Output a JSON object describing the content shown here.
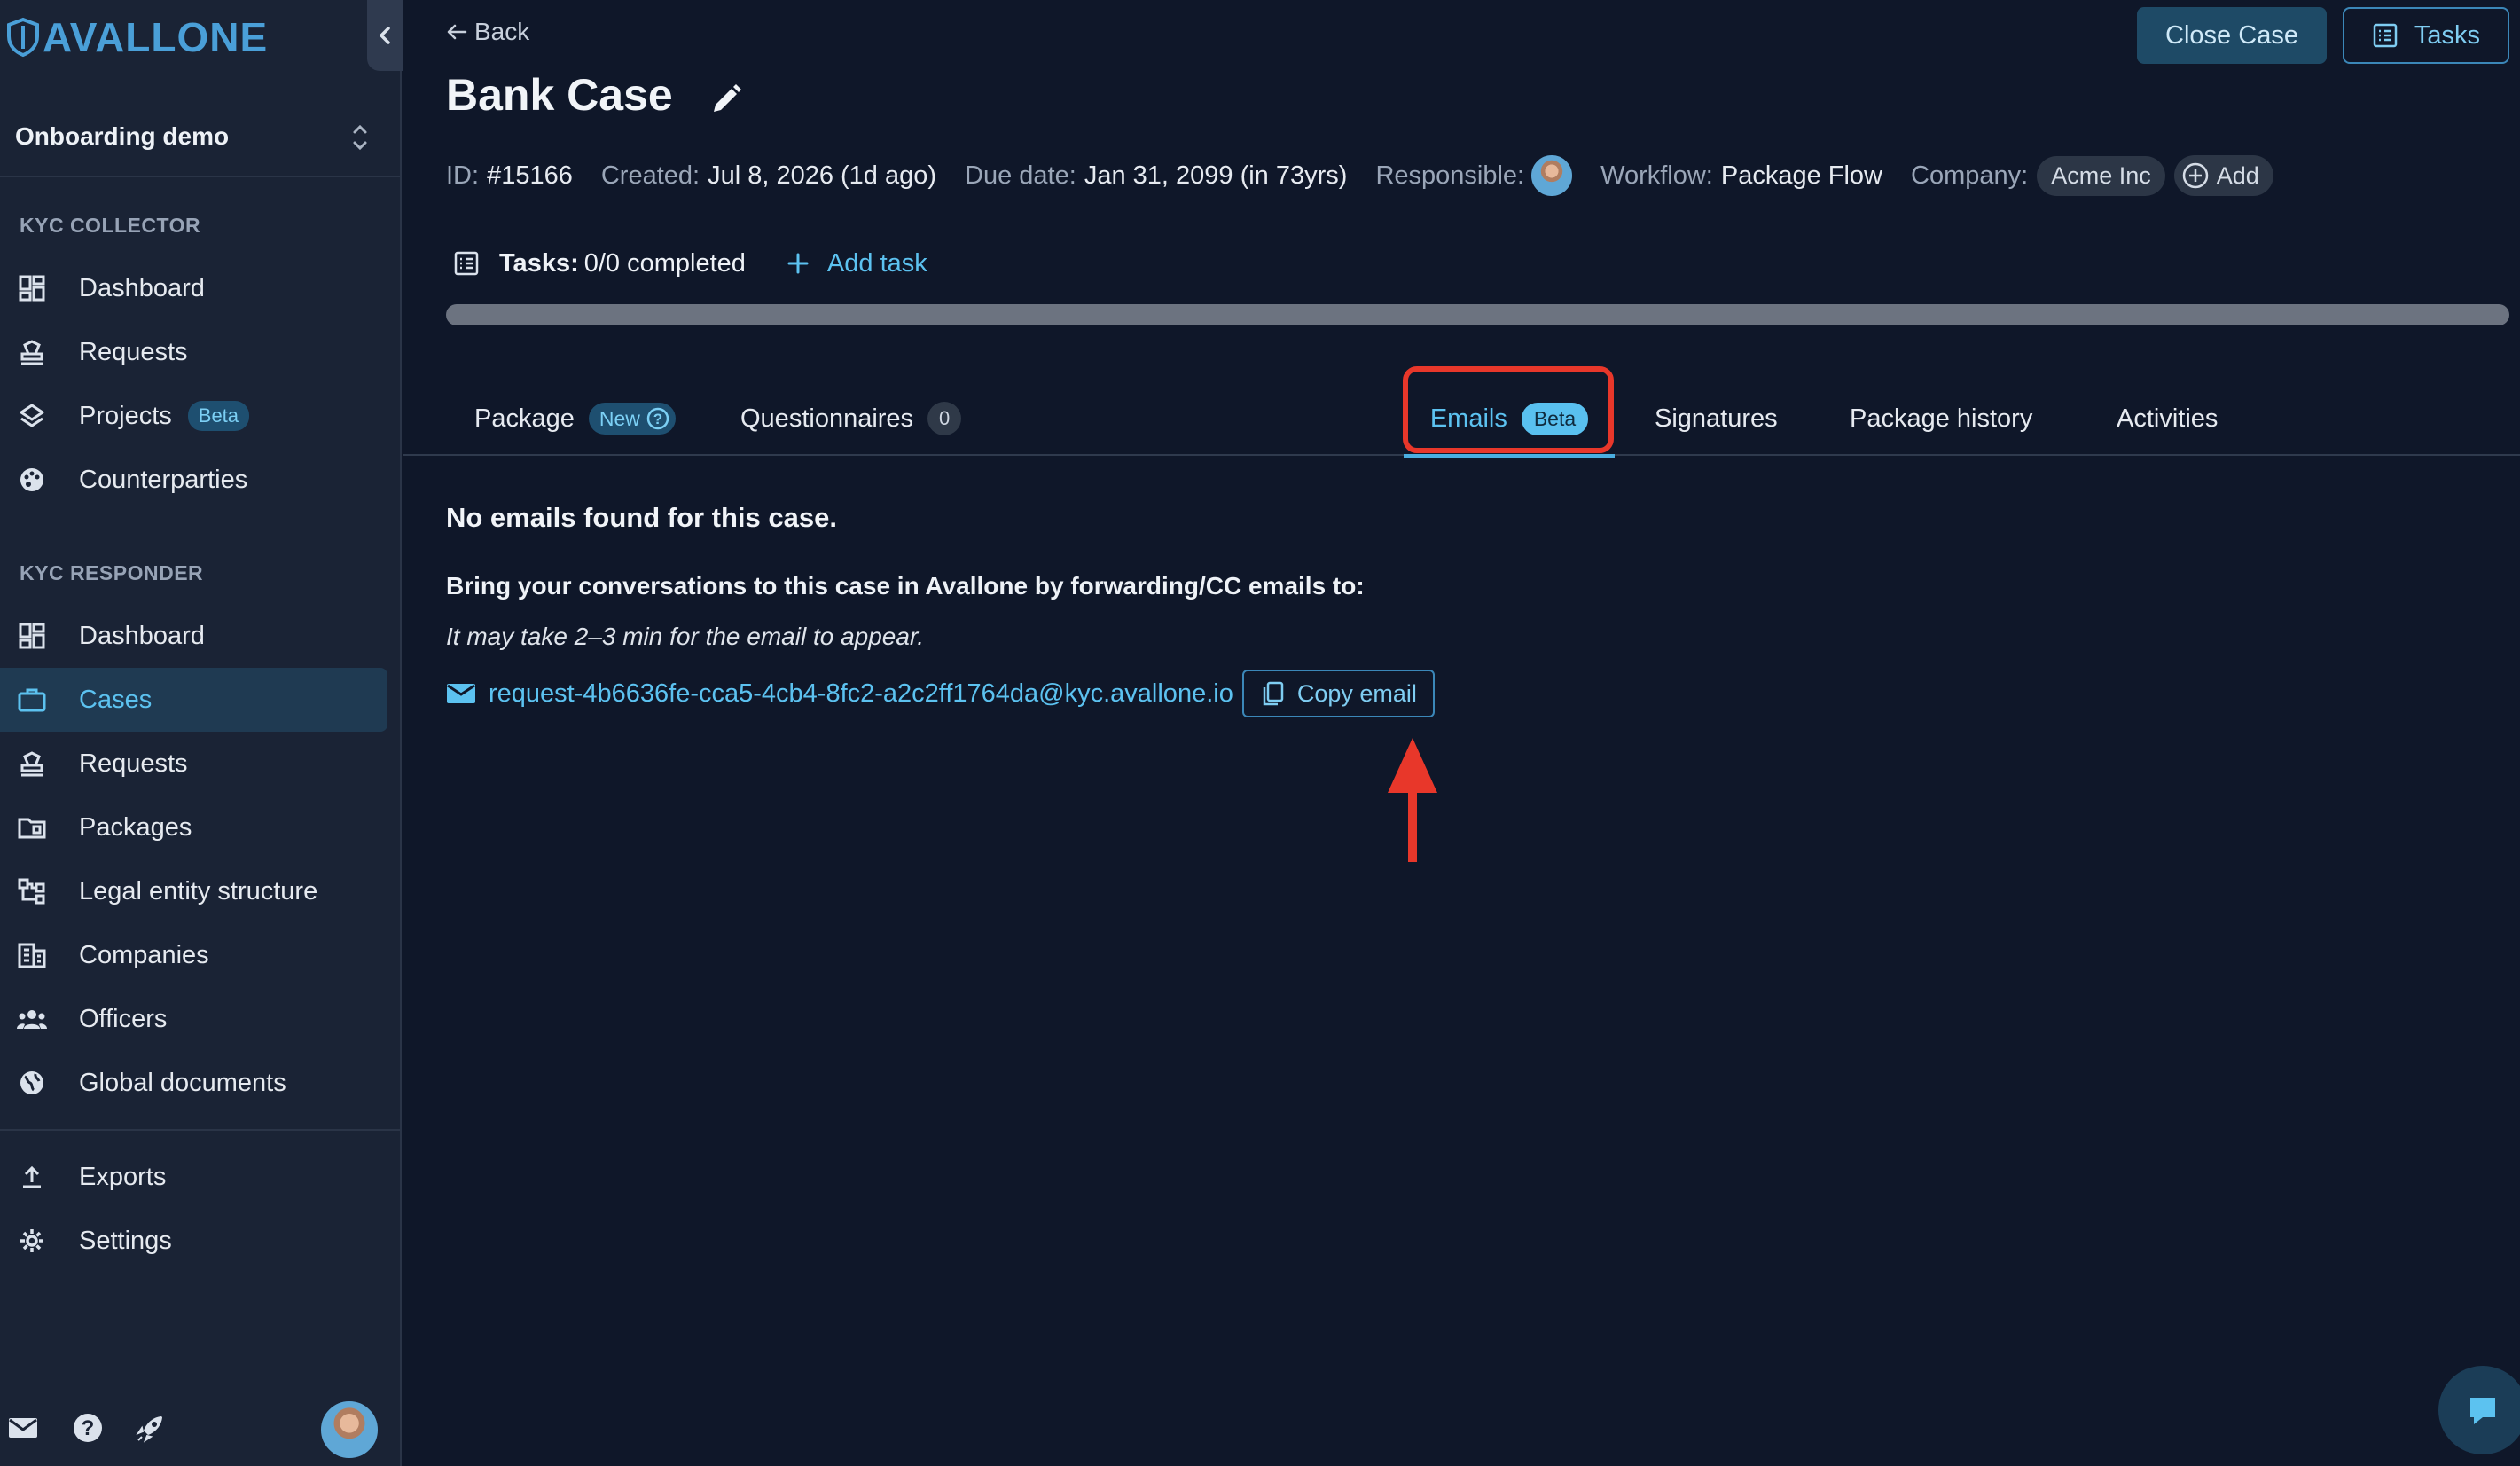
{
  "app": {
    "logo_text": "AVALLONE",
    "workspace": "Onboarding demo"
  },
  "sidebar": {
    "sections": [
      {
        "label": "KYC COLLECTOR",
        "items": [
          {
            "label": "Dashboard",
            "icon": "dashboard-icon"
          },
          {
            "label": "Requests",
            "icon": "stamp-icon"
          },
          {
            "label": "Projects",
            "icon": "layers-icon",
            "badge": "Beta"
          },
          {
            "label": "Counterparties",
            "icon": "palette-icon"
          }
        ]
      },
      {
        "label": "KYC RESPONDER",
        "items": [
          {
            "label": "Dashboard",
            "icon": "dashboard-icon"
          },
          {
            "label": "Cases",
            "icon": "briefcase-icon",
            "active": true
          },
          {
            "label": "Requests",
            "icon": "stamp-icon"
          },
          {
            "label": "Packages",
            "icon": "folder-icon"
          },
          {
            "label": "Legal entity structure",
            "icon": "hierarchy-icon"
          },
          {
            "label": "Companies",
            "icon": "building-icon"
          },
          {
            "label": "Officers",
            "icon": "people-icon"
          },
          {
            "label": "Global documents",
            "icon": "globe-icon"
          }
        ]
      }
    ],
    "bottom_items": [
      {
        "label": "Exports",
        "icon": "upload-icon"
      },
      {
        "label": "Settings",
        "icon": "gear-icon"
      }
    ],
    "footer_icons": [
      "mail-icon",
      "help-icon",
      "rocket-icon"
    ]
  },
  "header": {
    "back_label": "Back",
    "close_case_label": "Close Case",
    "tasks_label": "Tasks",
    "title": "Bank Case"
  },
  "meta": {
    "id_label": "ID:",
    "id_value": "#15166",
    "created_label": "Created:",
    "created_value": "Jul 8, 2026 (1d ago)",
    "due_label": "Due date:",
    "due_value": "Jan 31, 2099 (in 73yrs)",
    "responsible_label": "Responsible:",
    "workflow_label": "Workflow:",
    "workflow_value": "Package Flow",
    "company_label": "Company:",
    "company_value": "Acme Inc",
    "add_label": "Add"
  },
  "tasks": {
    "label": "Tasks:",
    "value": "0/0 completed",
    "add_label": "Add task",
    "progress": 0
  },
  "tabs": [
    {
      "label": "Package",
      "badge": "New"
    },
    {
      "label": "Questionnaires",
      "count": "0"
    },
    {
      "label": "Emails",
      "badge": "Beta",
      "active": true
    },
    {
      "label": "Signatures"
    },
    {
      "label": "Package history"
    },
    {
      "label": "Activities"
    }
  ],
  "emails": {
    "empty_title": "No emails found for this case.",
    "instruction": "Bring your conversations to this case in Avallone by forwarding/CC emails to:",
    "note": "It may take 2–3 min for the email to appear.",
    "address": "request-4b6636fe-cca5-4cb4-8fc2-a2c2ff1764da@kyc.avallone.io",
    "copy_label": "Copy email"
  },
  "colors": {
    "accent": "#5cc2f0",
    "background": "#0f1729",
    "sidebar": "#1a2335",
    "annotation": "#e8372a"
  }
}
